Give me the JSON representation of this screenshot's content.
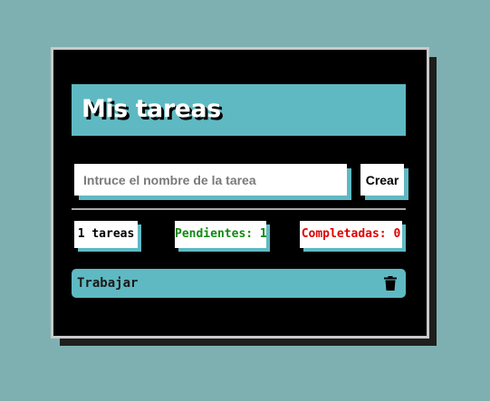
{
  "app": {
    "title": "Mis tareas"
  },
  "new_task": {
    "placeholder": "Intruce el nombre de la tarea",
    "value": "",
    "create_label": "Crear"
  },
  "stats": {
    "total_label": "1 tareas",
    "pending_label": "Pendientes: 1",
    "completed_label": "Completadas: 0"
  },
  "tasks": [
    {
      "name": "Trabajar",
      "icon": "trash-icon"
    }
  ],
  "colors": {
    "background": "#7fb0b1",
    "panel": "#000000",
    "accent": "#5fb9c2",
    "pending": "#128a12",
    "completed": "#e00000"
  }
}
